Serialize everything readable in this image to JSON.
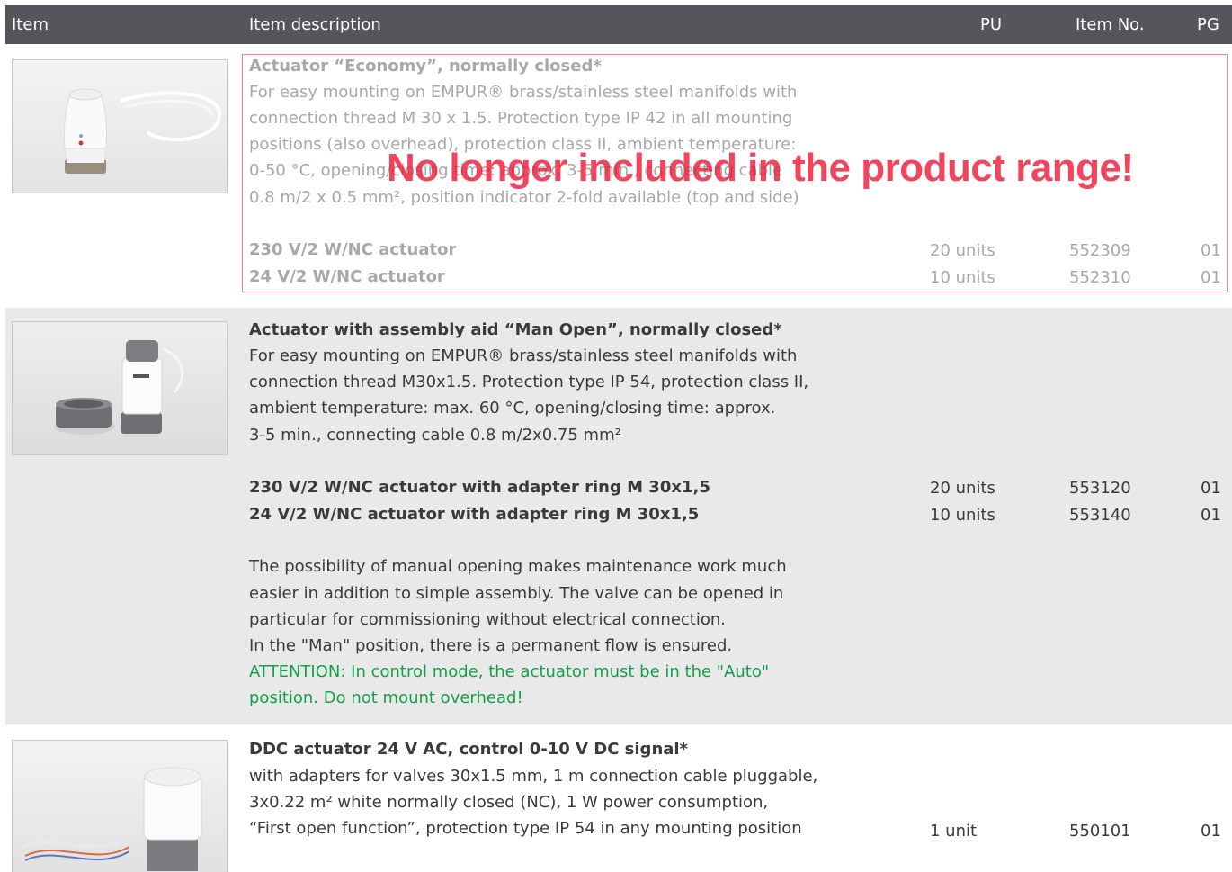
{
  "header": {
    "col_item": "Item",
    "col_description": "Item description",
    "col_pu": "PU",
    "col_itemno": "Item No.",
    "col_pg": "PG"
  },
  "products": [
    {
      "title": "Actuator “Economy”, normally closed*",
      "description": [
        "For easy mounting on EMPUR® brass/stainless steel manifolds with",
        "connection thread M 30 x 1.5. Protection type IP 42 in all mounting",
        "positions (also overhead), protection class II, ambient temperature:",
        "0-50 °C, opening/closing time: approx. 3-5 min., connecting cable",
        "0.8 m/2 x 0.5 mm², position indicator 2-fold available (top and side)"
      ],
      "variants": [
        {
          "name": "230 V/2 W/NC actuator",
          "pu": "20 units",
          "item_no": "552309",
          "pg": "01"
        },
        {
          "name": "24 V/2 W/NC actuator",
          "pu": "10 units",
          "item_no": "552310",
          "pg": "01"
        }
      ],
      "stamp": "No longer included in the product range!"
    },
    {
      "title": "Actuator with assembly aid “Man Open”, normally closed*",
      "description": [
        "For easy mounting on EMPUR® brass/stainless steel manifolds with",
        "connection thread M30x1.5. Protection type IP 54, protection class II,",
        "ambient temperature: max. 60 °C, opening/closing time: approx.",
        "3-5 min., connecting cable 0.8 m/2x0.75 mm²"
      ],
      "variants": [
        {
          "name": "230 V/2 W/NC actuator with adapter ring M 30x1,5",
          "pu": "20 units",
          "item_no": "553120",
          "pg": "01"
        },
        {
          "name": "24 V/2 W/NC actuator with adapter ring M 30x1,5",
          "pu": "10 units",
          "item_no": "553140",
          "pg": "01"
        }
      ],
      "notes": [
        "The possibility of manual opening makes maintenance work much",
        "easier in addition to simple assembly. The valve can be opened in",
        "particular for commissioning without electrical connection.",
        "In the \"Man\" position, there is a permanent flow is ensured."
      ],
      "attention": [
        "ATTENTION: In control mode, the actuator must be in the \"Auto\"",
        "position. Do not mount overhead!"
      ]
    },
    {
      "title": "DDC actuator 24 V AC, control 0-10 V DC signal*",
      "description": [
        "with adapters for valves 30x1.5 mm, 1 m connection cable pluggable,",
        "3x0.22 m² white normally closed (NC), 1 W power consumption,",
        "“First open function”, protection type IP 54 in any mounting position"
      ],
      "variants": [
        {
          "name": "",
          "pu": "1 unit",
          "item_no": "550101",
          "pg": "01"
        }
      ]
    }
  ],
  "colors": {
    "header_bg": "#55565a",
    "section_bg": "#e9e9ea",
    "discontinued_grey": "#a8a8a8",
    "stamp_red": "#ee1c3a",
    "attention_green": "#12a04a"
  }
}
